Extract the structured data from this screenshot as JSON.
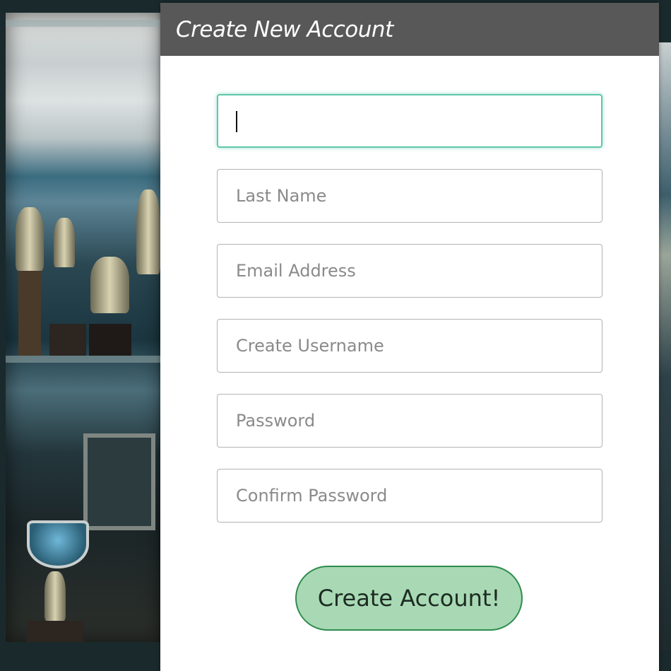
{
  "form": {
    "title": "Create New Account",
    "fields": [
      {
        "name": "first-name-field",
        "placeholder": "",
        "value": ""
      },
      {
        "name": "last-name-field",
        "placeholder": "Last Name",
        "value": ""
      },
      {
        "name": "email-field",
        "placeholder": "Email Address",
        "value": ""
      },
      {
        "name": "username-field",
        "placeholder": "Create Username",
        "value": ""
      },
      {
        "name": "password-field",
        "placeholder": "Password",
        "value": ""
      },
      {
        "name": "confirm-password-field",
        "placeholder": "Confirm Password",
        "value": ""
      }
    ],
    "submit_label": "Create Account!"
  },
  "colors": {
    "header_bg": "#585858",
    "focus_accent": "#5fc7aa",
    "button_bg": "#a8d9b4",
    "button_border": "#2f8c4d"
  }
}
